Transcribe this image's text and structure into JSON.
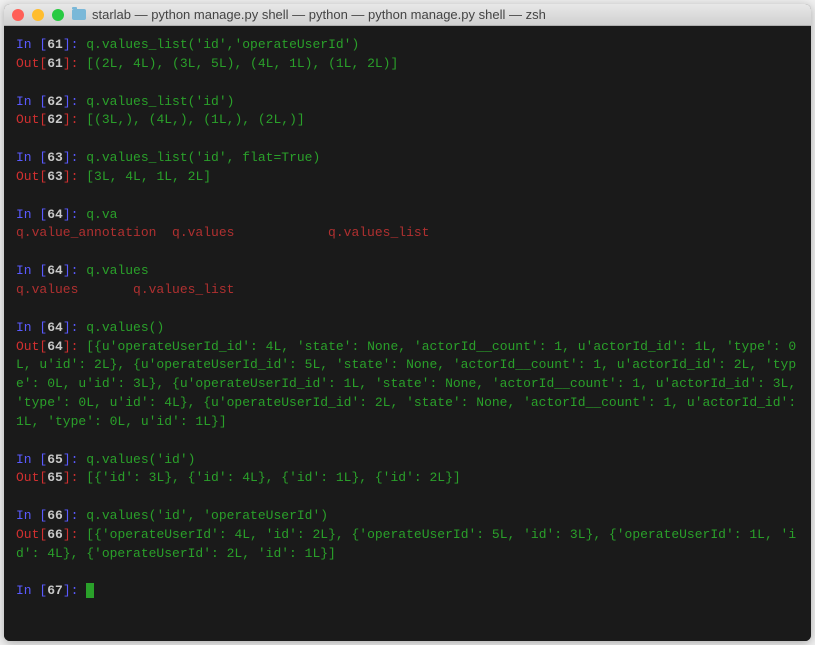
{
  "window": {
    "title": "starlab — python manage.py shell — python — python manage.py shell — zsh"
  },
  "prompts": {
    "in_prefix": "In [",
    "out_prefix": "Out[",
    "suffix": "]: "
  },
  "lines": [
    {
      "t": "in",
      "n": "61",
      "code": "q.values_list('id','operateUserId')"
    },
    {
      "t": "out",
      "n": "61",
      "text": "[(2L, 4L), (3L, 5L), (4L, 1L), (1L, 2L)]"
    },
    {
      "t": "blank"
    },
    {
      "t": "in",
      "n": "62",
      "code": "q.values_list('id')"
    },
    {
      "t": "out",
      "n": "62",
      "text": "[(3L,), (4L,), (1L,), (2L,)]"
    },
    {
      "t": "blank"
    },
    {
      "t": "in",
      "n": "63",
      "code": "q.values_list('id', flat=True)"
    },
    {
      "t": "out",
      "n": "63",
      "text": "[3L, 4L, 1L, 2L]"
    },
    {
      "t": "blank"
    },
    {
      "t": "in",
      "n": "64",
      "code": "q.va"
    },
    {
      "t": "comp",
      "text": "q.value_annotation  q.values            q.values_list"
    },
    {
      "t": "blank"
    },
    {
      "t": "in",
      "n": "64",
      "code": "q.values"
    },
    {
      "t": "comp",
      "text": "q.values       q.values_list"
    },
    {
      "t": "blank"
    },
    {
      "t": "in",
      "n": "64",
      "code": "q.values()"
    },
    {
      "t": "out",
      "n": "64",
      "text": "[{u'operateUserId_id': 4L, 'state': None, 'actorId__count': 1, u'actorId_id': 1L, 'type': 0L, u'id': 2L}, {u'operateUserId_id': 5L, 'state': None, 'actorId__count': 1, u'actorId_id': 2L, 'type': 0L, u'id': 3L}, {u'operateUserId_id': 1L, 'state': None, 'actorId__count': 1, u'actorId_id': 3L, 'type': 0L, u'id': 4L}, {u'operateUserId_id': 2L, 'state': None, 'actorId__count': 1, u'actorId_id': 1L, 'type': 0L, u'id': 1L}]"
    },
    {
      "t": "blank"
    },
    {
      "t": "in",
      "n": "65",
      "code": "q.values('id')"
    },
    {
      "t": "out",
      "n": "65",
      "text": "[{'id': 3L}, {'id': 4L}, {'id': 1L}, {'id': 2L}]"
    },
    {
      "t": "blank"
    },
    {
      "t": "in",
      "n": "66",
      "code": "q.values('id', 'operateUserId')"
    },
    {
      "t": "out",
      "n": "66",
      "text": "[{'operateUserId': 4L, 'id': 2L}, {'operateUserId': 5L, 'id': 3L}, {'operateUserId': 1L, 'id': 4L}, {'operateUserId': 2L, 'id': 1L}]"
    },
    {
      "t": "blank"
    },
    {
      "t": "in",
      "n": "67",
      "code": "",
      "cursor": true
    }
  ]
}
